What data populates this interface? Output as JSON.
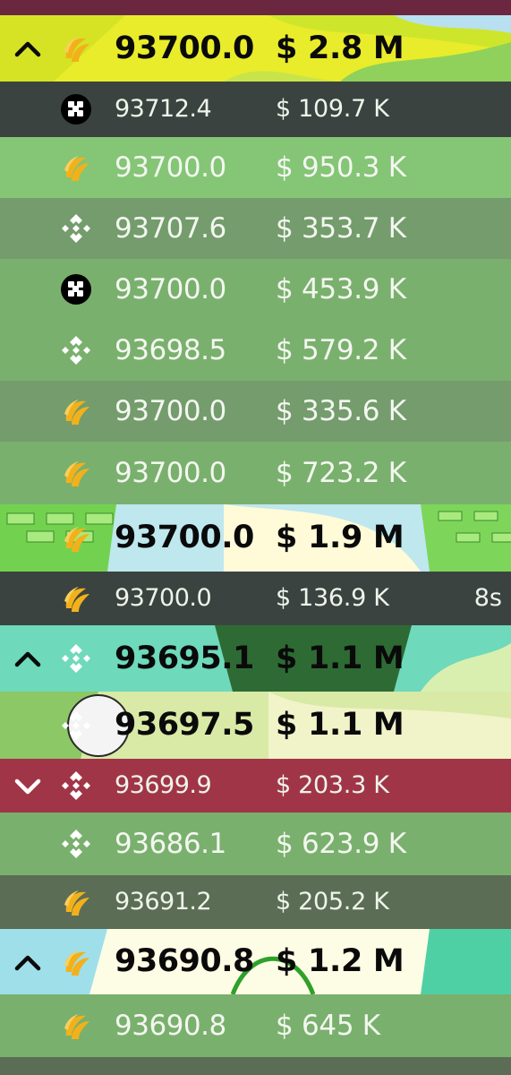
{
  "colors": {
    "top_strip": "#6b2740",
    "sell_red": "#a13548",
    "dark_slate": "#3b4340",
    "dark_olive": "#5c6d55",
    "light_green": "#84c576",
    "mid_green": "#749c6c",
    "sage": "#7ab06d",
    "hyperliquid_gold": "#f2b11b",
    "binance_white": "#ffffff",
    "okx_black": "#000000"
  },
  "trades": [
    {
      "price": "93700.0",
      "amount": "$ 2.8 M",
      "exchange": "hyperliquid-icon",
      "arrow": "up",
      "size": "large",
      "bg": "banner-yellow"
    },
    {
      "price": "93712.4",
      "amount": "$ 109.7 K",
      "exchange": "okx-icon",
      "arrow": "",
      "size": "small",
      "bg": "dark_slate"
    },
    {
      "price": "93700.0",
      "amount": "$ 950.3 K",
      "exchange": "hyperliquid-icon",
      "arrow": "",
      "size": "medium",
      "bg": "light_green"
    },
    {
      "price": "93707.6",
      "amount": "$ 353.7 K",
      "exchange": "binance-icon",
      "arrow": "",
      "size": "medium",
      "bg": "mid_green"
    },
    {
      "price": "93700.0",
      "amount": "$ 453.9 K",
      "exchange": "okx-icon",
      "arrow": "",
      "size": "medium",
      "bg": "sage"
    },
    {
      "price": "93698.5",
      "amount": "$ 579.2 K",
      "exchange": "binance-icon",
      "arrow": "",
      "size": "medium",
      "bg": "sage"
    },
    {
      "price": "93700.0",
      "amount": "$ 335.6 K",
      "exchange": "hyperliquid-icon",
      "arrow": "",
      "size": "medium",
      "bg": "mid_green"
    },
    {
      "price": "93700.0",
      "amount": "$ 723.2 K",
      "exchange": "hyperliquid-icon",
      "arrow": "",
      "size": "medium",
      "bg": "sage"
    },
    {
      "price": "93700.0",
      "amount": "$ 1.9 M",
      "exchange": "hyperliquid-icon",
      "arrow": "",
      "size": "large",
      "bg": "banner-money"
    },
    {
      "price": "93700.0",
      "amount": "$ 136.9 K",
      "exchange": "hyperliquid-icon",
      "arrow": "",
      "size": "small",
      "bg": "dark_slate",
      "time": "8s"
    },
    {
      "price": "93695.1",
      "amount": "$ 1.1 M",
      "exchange": "binance-icon",
      "arrow": "up",
      "size": "large",
      "bg": "banner-teal"
    },
    {
      "price": "93697.5",
      "amount": "$ 1.1 M",
      "exchange": "binance-icon",
      "arrow": "",
      "size": "large",
      "bg": "banner-field"
    },
    {
      "price": "93699.9",
      "amount": "$ 203.3 K",
      "exchange": "binance-icon",
      "arrow": "down",
      "size": "small",
      "bg": "sell_red"
    },
    {
      "price": "93686.1",
      "amount": "$ 623.9 K",
      "exchange": "binance-icon",
      "arrow": "",
      "size": "medium",
      "bg": "sage"
    },
    {
      "price": "93691.2",
      "amount": "$ 205.2 K",
      "exchange": "hyperliquid-icon",
      "arrow": "",
      "size": "small",
      "bg": "dark_olive"
    },
    {
      "price": "93690.8",
      "amount": "$ 1.2 M",
      "exchange": "hyperliquid-icon",
      "arrow": "up",
      "size": "large",
      "bg": "banner-pale"
    },
    {
      "price": "93690.8",
      "amount": "$ 645 K",
      "exchange": "hyperliquid-icon",
      "arrow": "",
      "size": "medium",
      "bg": "sage"
    }
  ]
}
